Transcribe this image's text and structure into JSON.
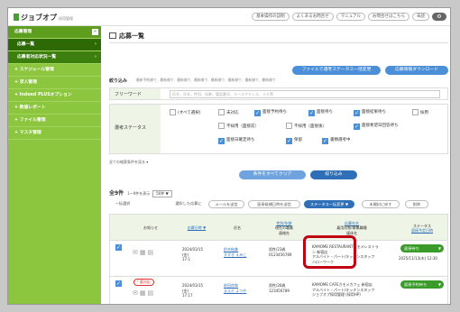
{
  "header": {
    "logo": "ジョブオプ",
    "logo_sub": "採用管理",
    "links": [
      "基本操作の説明",
      "よくあるお問合せ",
      "マニュアル",
      "お問合せはこちら",
      "未読"
    ],
    "gear_icon": "gear-icon"
  },
  "sidebar": {
    "items": [
      {
        "label": "応募管理",
        "type": "head"
      },
      {
        "label": "応募一覧",
        "type": "sub-active"
      },
      {
        "label": "応募者対応状況一覧",
        "type": "sub"
      },
      {
        "label": "スケジュール管理",
        "type": "item"
      },
      {
        "label": "求人管理",
        "type": "item"
      },
      {
        "label": "Indeed PLUSオプション",
        "type": "item"
      },
      {
        "label": "数値レポート",
        "type": "item"
      },
      {
        "label": "ファイル管理",
        "type": "item"
      },
      {
        "label": "マスタ管理",
        "type": "item"
      }
    ],
    "collapse": "«"
  },
  "main": {
    "title": "応募一覧",
    "btn_status_download": "ファイルで選考ステータス一括変更",
    "btn_app_download": "応募情報ダウンロード",
    "filter_title": "絞り込み",
    "filter_hint": "最新予約順で、最新順で、最新順で、最新順で、最新順で、最新順で、最新順で、最新順で",
    "freeword_label": "フリーワード",
    "freeword_placeholder": "氏名、氏名、性別、年齢、電話番号、メールアドレス、メモ等",
    "status_label": "選考ステータス",
    "status_options": [
      {
        "label": "(すべて選択)",
        "checked": false
      },
      {
        "label": "未対応",
        "checked": false
      },
      {
        "label": "面接予約待ち",
        "checked": true
      },
      {
        "label": "面接待ち",
        "checked": true
      },
      {
        "label": "面接結果待ち",
        "checked": true
      },
      {
        "label": "採用",
        "checked": false
      },
      {
        "label": "不採用（面接前）",
        "checked": false
      },
      {
        "label": "不採用（面接後）",
        "checked": false
      },
      {
        "label": "面接希望日回答待ち",
        "checked": true
      },
      {
        "label": "面接日確定待ち",
        "checked": true
      },
      {
        "label": "保留",
        "checked": true
      },
      {
        "label": "書類選考中",
        "checked": true
      }
    ],
    "more_conditions": "全ての検索条件を見る ▾",
    "btn_clear": "条件をすべてクリア",
    "btn_search": "絞り込み",
    "count": "全9件",
    "count_detail": "1〜9件を表示",
    "per_page": "50件 ▼",
    "actions": [
      "一括選択",
      "選択した応募に",
      "メールを送信",
      "面接候補日時を送信",
      "ステータス一括変更 ▼",
      "未開封に戻す",
      "削除"
    ]
  },
  "table": {
    "headers": {
      "notify": "お知らせ",
      "date": "応募日時 ▼",
      "name": "氏名",
      "gender_label": "性別/年齢",
      "gender_sub1": "現在の職業",
      "gender_sub2": "連絡先",
      "job_label": "応募先名",
      "job_sub1": "雇用形態/募集職種",
      "job_sub2": "媒体名",
      "status_label": "ステータス",
      "status_sub": "面接予定日時"
    },
    "rows": [
      {
        "badge": "",
        "date": "2024/03/15",
        "weekday": "(金)",
        "time": "17:1",
        "name": "鈴木絵美",
        "kana": "すずき えみこ",
        "gender": "男性/23歳",
        "phone": "0123456789",
        "job": "KAMOME RESTAURANTカモメレストラ",
        "job2": "ン 新宿店",
        "job3": "アルバイト・パート/キッチンスタッフ",
        "job4": "ハローワーク",
        "status": "面接待ち",
        "status_date": "2025/11/13(木) 12:30"
      },
      {
        "badge": "! 要対応",
        "date": "2024/03/15",
        "weekday": "(金)",
        "time": "17:17",
        "name": "前田良和",
        "kana": "まえだ よつや",
        "gender": "男性/26歳",
        "phone": "123456789",
        "job": "KAMOME CAFEカモメカフェ 新宿店",
        "job2": "アルバイト・パート/キッチンスタッフ",
        "job3": "ジョブオプ採用管理 (採用HP)",
        "job4": "",
        "status": "面接予約待ち",
        "status_date": ""
      }
    ]
  }
}
